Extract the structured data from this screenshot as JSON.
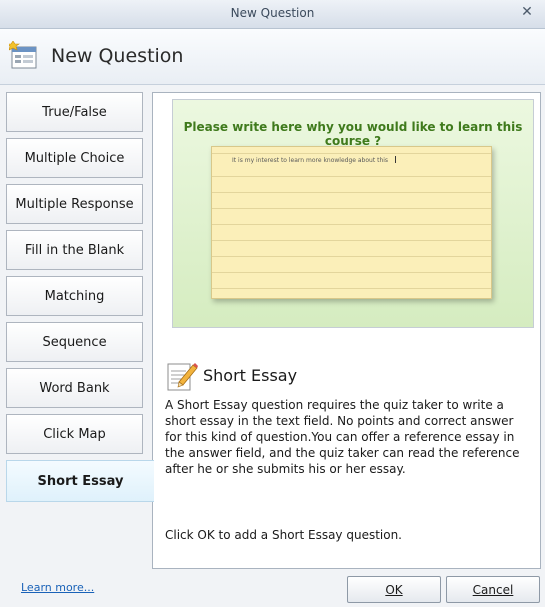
{
  "window": {
    "title": "New Question"
  },
  "header": {
    "title": "New Question"
  },
  "question_types": [
    {
      "label": "True/False"
    },
    {
      "label": "Multiple Choice"
    },
    {
      "label": "Multiple Response"
    },
    {
      "label": "Fill in the Blank"
    },
    {
      "label": "Matching"
    },
    {
      "label": "Sequence"
    },
    {
      "label": "Word Bank"
    },
    {
      "label": "Click Map"
    },
    {
      "label": "Short Essay"
    }
  ],
  "selected_type": "Short Essay",
  "preview": {
    "prompt": "Please write here why you would like to learn this course ?",
    "answer_text": "It is my interest to learn more knowledge about this"
  },
  "detail": {
    "title": "Short Essay",
    "description": "A Short Essay question requires the quiz taker to write a short essay in the text field. No points and correct answer for this kind of question.You can offer a reference essay in the answer field, and the quiz taker can read the reference after he or she submits his or her essay.",
    "hint": "Click OK to add a Short Essay question."
  },
  "footer": {
    "learn_more": "Learn more...",
    "ok_label": "OK",
    "cancel_label": "Cancel"
  },
  "icons": {
    "window_close": "close-icon",
    "header": "new-question-icon",
    "essay": "essay-pencil-icon"
  },
  "colors": {
    "prompt_green": "#3f7a1c",
    "paper_yellow": "#fbefb9",
    "link_blue": "#1a62b8",
    "selected_tab": "#dff1fb"
  }
}
